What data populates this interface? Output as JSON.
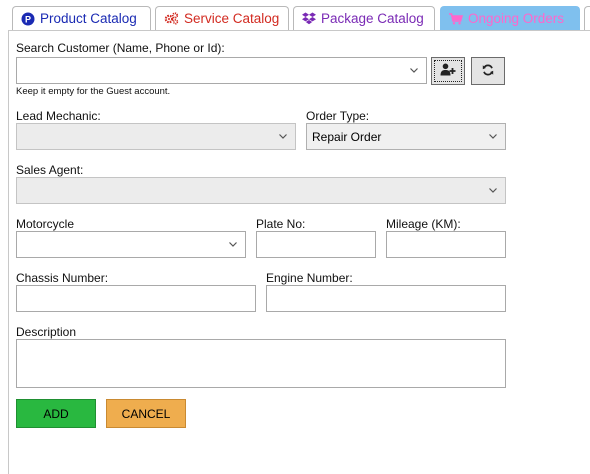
{
  "tabs": [
    {
      "label": "Product Catalog",
      "icon": "product-p-circle-icon"
    },
    {
      "label": "Service Catalog",
      "icon": "gears-icon"
    },
    {
      "label": "Package Catalog",
      "icon": "dropbox-icon"
    },
    {
      "label": "Ongoing Orders",
      "icon": "cart-icon"
    }
  ],
  "colors": {
    "product_tab": "#1a2ab3",
    "service_tab": "#d22a20",
    "package_tab": "#7a2ab5",
    "orders_tab_bg": "#7fc0ee",
    "orders_tab_text": "#ff66cc",
    "add_button": "#29b840",
    "cancel_button": "#efad4e"
  },
  "form": {
    "search_customer": {
      "label": "Search Customer (Name, Phone or Id):",
      "value": "",
      "hint": "Keep it empty for the Guest account.",
      "add_icon": "add-user-icon",
      "refresh_icon": "refresh-icon"
    },
    "lead_mechanic": {
      "label": "Lead Mechanic:",
      "value": ""
    },
    "order_type": {
      "label": "Order Type:",
      "value": "Repair Order"
    },
    "sales_agent": {
      "label": "Sales Agent:",
      "value": ""
    },
    "motorcycle": {
      "label": "Motorcycle",
      "value": ""
    },
    "plate_no": {
      "label": "Plate No:",
      "value": ""
    },
    "mileage": {
      "label": "Mileage (KM):",
      "value": ""
    },
    "chassis_number": {
      "label": "Chassis Number:",
      "value": ""
    },
    "engine_number": {
      "label": "Engine Number:",
      "value": ""
    },
    "description": {
      "label": "Description",
      "value": ""
    }
  },
  "buttons": {
    "add": "ADD",
    "cancel": "CANCEL"
  }
}
